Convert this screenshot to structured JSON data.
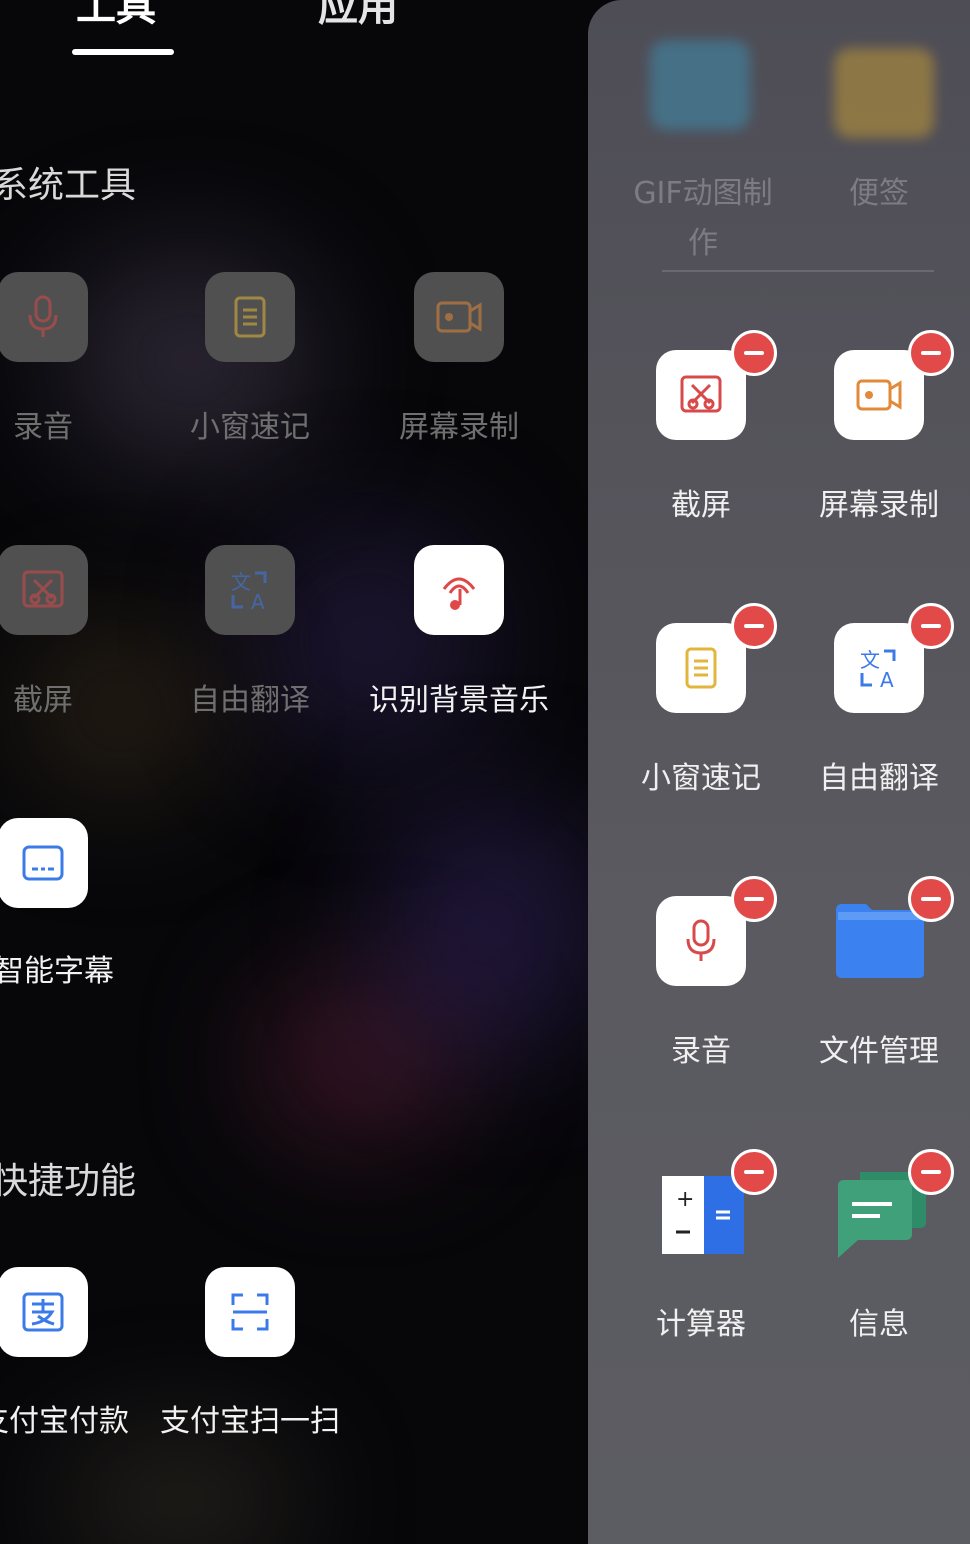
{
  "tabs": {
    "tools": "工具",
    "apps": "应用"
  },
  "sections": {
    "system_tools": "系统工具",
    "quick_functions": "快捷功能"
  },
  "system_tools": [
    {
      "label": "录音",
      "icon": "microphone-icon",
      "enabled": false
    },
    {
      "label": "小窗速记",
      "icon": "note-icon",
      "enabled": false
    },
    {
      "label": "屏幕录制",
      "icon": "screen-record-icon",
      "enabled": false
    },
    {
      "label": "截屏",
      "icon": "screenshot-icon",
      "enabled": false
    },
    {
      "label": "自由翻译",
      "icon": "translate-icon",
      "enabled": false
    },
    {
      "label": "识别背景音乐",
      "icon": "music-recognize-icon",
      "enabled": true
    },
    {
      "label": "智能字幕",
      "icon": "subtitle-icon",
      "enabled": true
    }
  ],
  "quick_functions": [
    {
      "label": "支付宝付款",
      "icon": "alipay-pay-icon"
    },
    {
      "label": "支付宝扫一扫",
      "icon": "scan-icon"
    }
  ],
  "panel": {
    "faint_items": [
      {
        "label_line1": "GIF动图制",
        "label_line2": "作"
      },
      {
        "label_line1": "便签",
        "label_line2": ""
      }
    ],
    "items": [
      {
        "label": "截屏",
        "icon": "screenshot-icon"
      },
      {
        "label": "屏幕录制",
        "icon": "screen-record-icon"
      },
      {
        "label": "小窗速记",
        "icon": "note-icon"
      },
      {
        "label": "自由翻译",
        "icon": "translate-icon"
      },
      {
        "label": "录音",
        "icon": "microphone-icon"
      },
      {
        "label": "文件管理",
        "icon": "folder-icon"
      },
      {
        "label": "计算器",
        "icon": "calculator-icon"
      },
      {
        "label": "信息",
        "icon": "messages-icon"
      }
    ]
  },
  "colors": {
    "accent_red": "#e24a4a",
    "folder_blue": "#3b82f0",
    "message_green": "#3fa07a"
  }
}
